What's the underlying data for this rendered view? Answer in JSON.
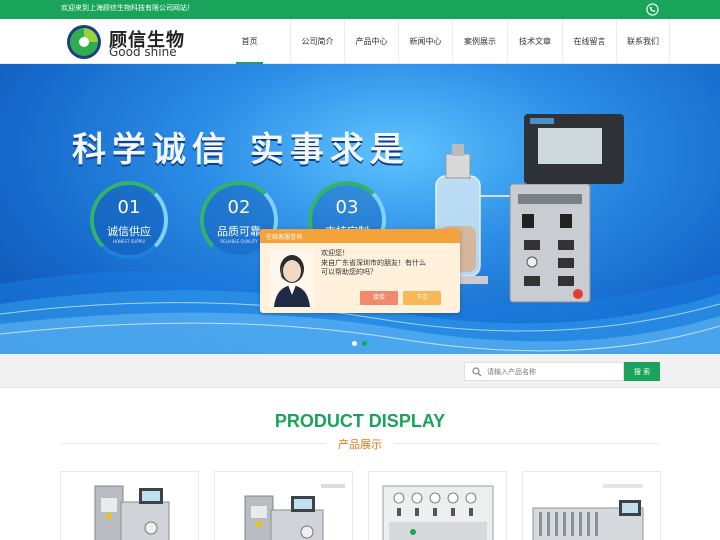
{
  "topbar": {
    "welcome": "欢迎来到上海顾信生物科技有限公司网站！",
    "icon": "phone-icon"
  },
  "logo": {
    "name_cn": "顾信生物",
    "name_en": "Good shine"
  },
  "nav": {
    "items": [
      {
        "label": "首页",
        "active": true
      },
      {
        "label": "公司简介"
      },
      {
        "label": "产品中心"
      },
      {
        "label": "新闻中心"
      },
      {
        "label": "案例展示"
      },
      {
        "label": "技术文章"
      },
      {
        "label": "在线留言"
      },
      {
        "label": "联系我们"
      }
    ]
  },
  "banner": {
    "slogan": "科学诚信  实事求是",
    "circles": [
      {
        "num": "01",
        "label": "诚信供应",
        "sub": "HONEST SUPPLY"
      },
      {
        "num": "02",
        "label": "品质可靠",
        "sub": "RELIABLE QUALITY"
      },
      {
        "num": "03",
        "label": "支持定制",
        "sub": ""
      }
    ],
    "active_slide": 2,
    "slide_count": 2
  },
  "chat": {
    "header": "在线客服咨询",
    "greeting": "欢迎您！",
    "message_line1": "来自广东省深圳市的朋友！有什么",
    "message_line2": "可以帮助您的吗？",
    "accept_label": "接受",
    "later_label": "下次"
  },
  "search": {
    "placeholder": "请输入产品名称",
    "button_label": "搜 索"
  },
  "products": {
    "title": "PRODUCT DISPLAY",
    "subtitle": "产品展示"
  },
  "colors": {
    "brand_green": "#1aa35a",
    "accent_orange": "#e07a1a"
  }
}
